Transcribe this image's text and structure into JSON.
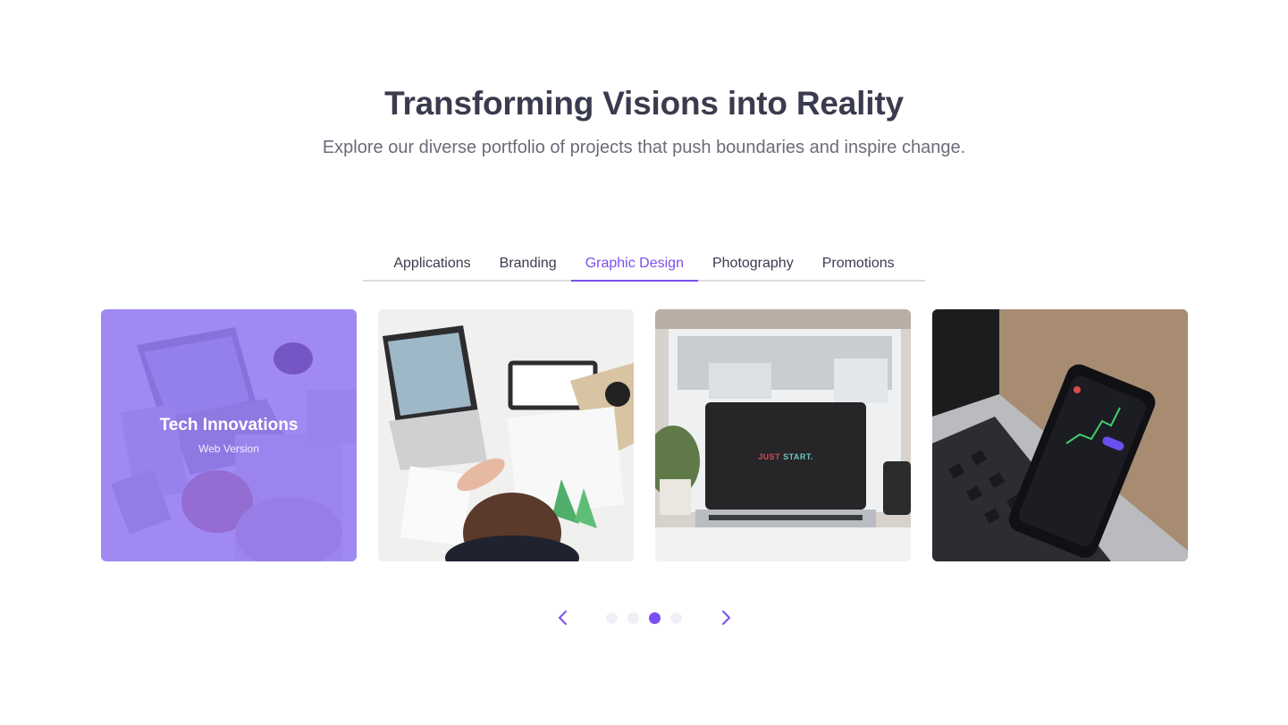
{
  "header": {
    "title": "Transforming Visions into Reality",
    "subtitle": "Explore our diverse portfolio of projects that push boundaries and inspire change."
  },
  "tabs": [
    {
      "label": "Applications",
      "active": false
    },
    {
      "label": "Branding",
      "active": false
    },
    {
      "label": "Graphic Design",
      "active": true
    },
    {
      "label": "Photography",
      "active": false
    },
    {
      "label": "Promotions",
      "active": false
    }
  ],
  "cards": [
    {
      "title": "Tech Innovations",
      "subtitle": "Web Version",
      "image": "desk-laptop-calculator-photo"
    },
    {
      "image": "person-sketching-at-desk-photo"
    },
    {
      "image": "laptop-just-start-photo",
      "screen_text_1": "JUST",
      "screen_text_2": "START."
    },
    {
      "image": "phone-trading-app-on-laptop-photo"
    }
  ],
  "carousel": {
    "prev_icon": "chevron-left-icon",
    "next_icon": "chevron-right-icon",
    "dot_count": 4,
    "active_dot": 3
  },
  "colors": {
    "accent": "#7b4ff0",
    "heading": "#3b3b4f",
    "text_muted": "#6b6b7b",
    "overlay": "#8060f0"
  }
}
